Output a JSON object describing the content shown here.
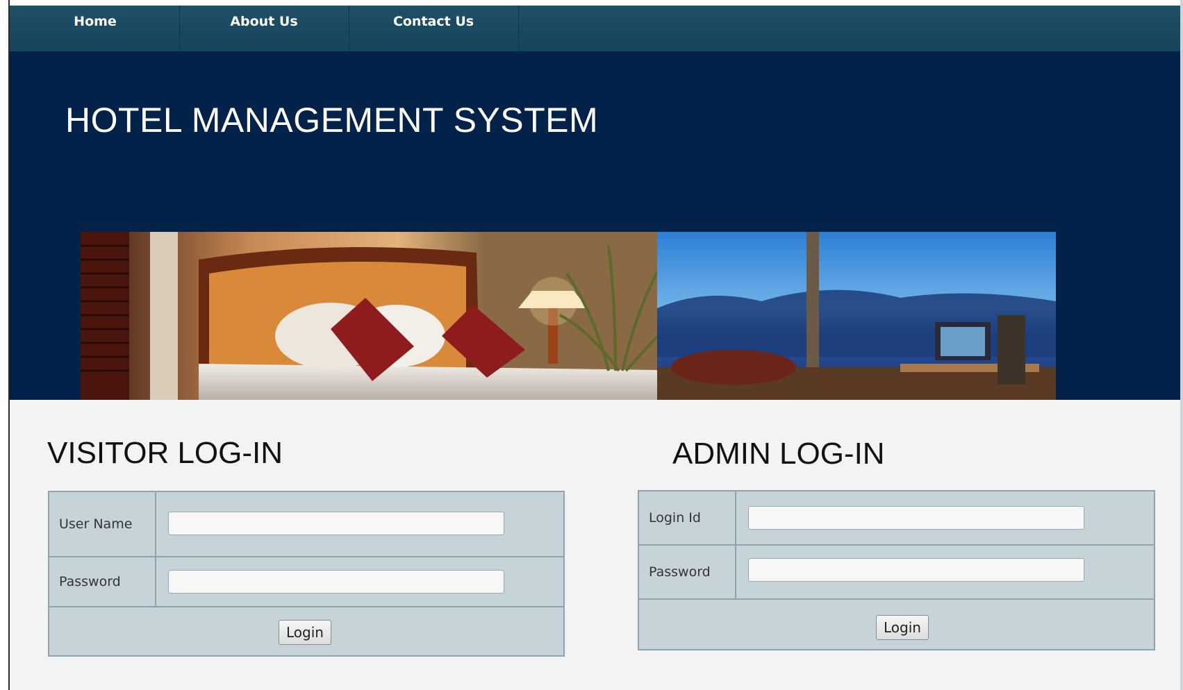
{
  "nav": {
    "items": [
      {
        "label": "Home"
      },
      {
        "label": "About Us"
      },
      {
        "label": "Contact Us"
      }
    ]
  },
  "header": {
    "title": "HOTEL MANAGEMENT SYSTEM"
  },
  "visitor_login": {
    "heading": "VISITOR LOG-IN",
    "username_label": "User Name",
    "username_value": "",
    "password_label": "Password",
    "password_value": "",
    "button_label": "Login"
  },
  "admin_login": {
    "heading": "ADMIN LOG-IN",
    "login_id_label": "Login Id",
    "login_id_value": "",
    "password_label": "Password",
    "password_value": "",
    "button_label": "Login"
  },
  "colors": {
    "nav_background": "#1a4a62",
    "banner_background": "#02224a",
    "form_background": "#c6d4d9",
    "page_background": "#f3f3f3"
  }
}
